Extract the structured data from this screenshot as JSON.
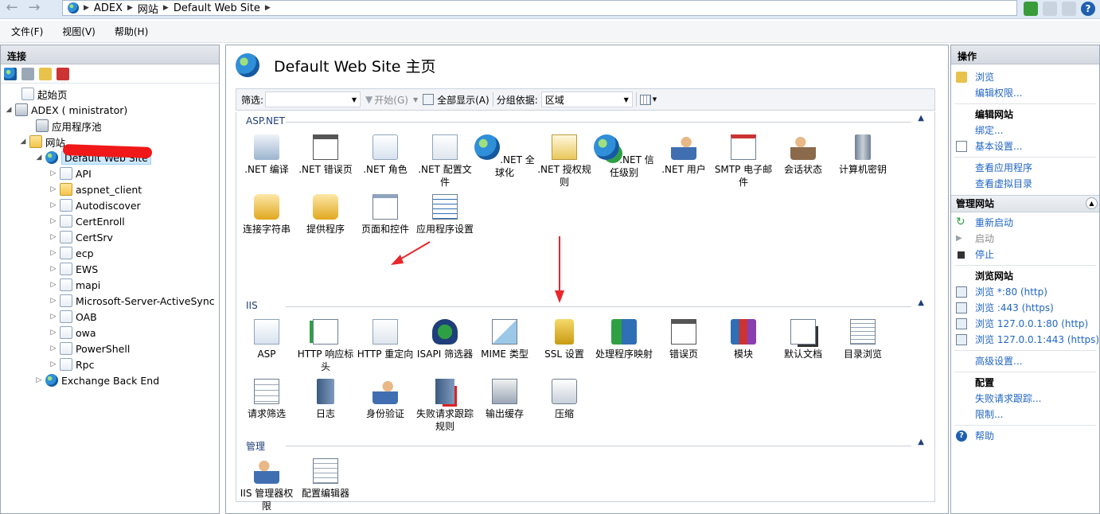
{
  "address": {
    "crumbs": [
      "ADEX",
      "网站",
      "Default Web Site"
    ]
  },
  "menu": [
    "文件(F)",
    "视图(V)",
    "帮助(H)"
  ],
  "connections": {
    "title": "连接",
    "tree": [
      {
        "label": "起始页",
        "icon": "start-page-icon"
      },
      {
        "label": "ADEX (                  ministrator)",
        "icon": "server-icon"
      },
      {
        "label": "应用程序池",
        "icon": "app-pools-icon"
      },
      {
        "label": "网站",
        "icon": "sites-folder-icon"
      },
      {
        "label": "Default Web Site",
        "icon": "website-globe-icon"
      },
      {
        "label": "API",
        "icon": "web-app-icon"
      },
      {
        "label": "aspnet_client",
        "icon": "folder-icon"
      },
      {
        "label": "Autodiscover",
        "icon": "web-app-icon"
      },
      {
        "label": "CertEnroll",
        "icon": "web-app-icon"
      },
      {
        "label": "CertSrv",
        "icon": "web-app-icon"
      },
      {
        "label": "ecp",
        "icon": "web-app-icon"
      },
      {
        "label": "EWS",
        "icon": "web-app-icon"
      },
      {
        "label": "mapi",
        "icon": "web-app-icon"
      },
      {
        "label": "Microsoft-Server-ActiveSync",
        "icon": "web-app-icon"
      },
      {
        "label": "OAB",
        "icon": "web-app-icon"
      },
      {
        "label": "owa",
        "icon": "web-app-icon"
      },
      {
        "label": "PowerShell",
        "icon": "web-app-icon"
      },
      {
        "label": "Rpc",
        "icon": "web-app-icon"
      },
      {
        "label": "Exchange Back End",
        "icon": "website-globe-icon"
      }
    ]
  },
  "center": {
    "title": "Default Web Site 主页",
    "filter": {
      "label": "筛选:",
      "start": "开始(G)",
      "show_all": "全部显示(A)",
      "group_by": "分组依据:",
      "group_value": "区域"
    },
    "groups": [
      {
        "name": "ASP.NET",
        "features": [
          ".NET 编译",
          ".NET 错误页",
          ".NET 角色",
          ".NET 配置文件",
          ".NET 全球化",
          ".NET 授权规则",
          ".NET 信任级别",
          ".NET 用户",
          "SMTP 电子邮件",
          "会话状态",
          "计算机密钥",
          "连接字符串",
          "提供程序",
          "页面和控件",
          "应用程序设置"
        ]
      },
      {
        "name": "IIS",
        "features": [
          "ASP",
          "HTTP 响应标头",
          "HTTP 重定向",
          "ISAPI 筛选器",
          "MIME 类型",
          "SSL 设置",
          "处理程序映射",
          "错误页",
          "模块",
          "默认文档",
          "目录浏览",
          "请求筛选",
          "日志",
          "身份验证",
          "失败请求跟踪规则",
          "输出缓存",
          "压缩"
        ]
      },
      {
        "name": "管理",
        "features": [
          "IIS 管理器权限",
          "配置编辑器"
        ]
      }
    ]
  },
  "actions": {
    "title": "操作",
    "browse": "浏览",
    "edit_perms": "编辑权限...",
    "edit_site_h": "编辑网站",
    "bindings": "绑定...",
    "basic_settings": "基本设置...",
    "view_apps": "查看应用程序",
    "view_vdirs": "查看虚拟目录",
    "manage_h": "管理网站",
    "restart": "重新启动",
    "start": "启动",
    "stop": "停止",
    "browse_h": "浏览网站",
    "browse_links": [
      "浏览 *:80 (http)",
      "浏览 :443 (https)",
      "浏览 127.0.0.1:80 (http)",
      "浏览 127.0.0.1:443 (https)"
    ],
    "advanced": "高级设置...",
    "config_h": "配置",
    "failed_trace": "失败请求跟踪...",
    "limits": "限制...",
    "help": "帮助"
  },
  "colors": {
    "link": "#2166c4",
    "header": "#1e3f7a",
    "annotation_arrow": "#e8262b"
  }
}
